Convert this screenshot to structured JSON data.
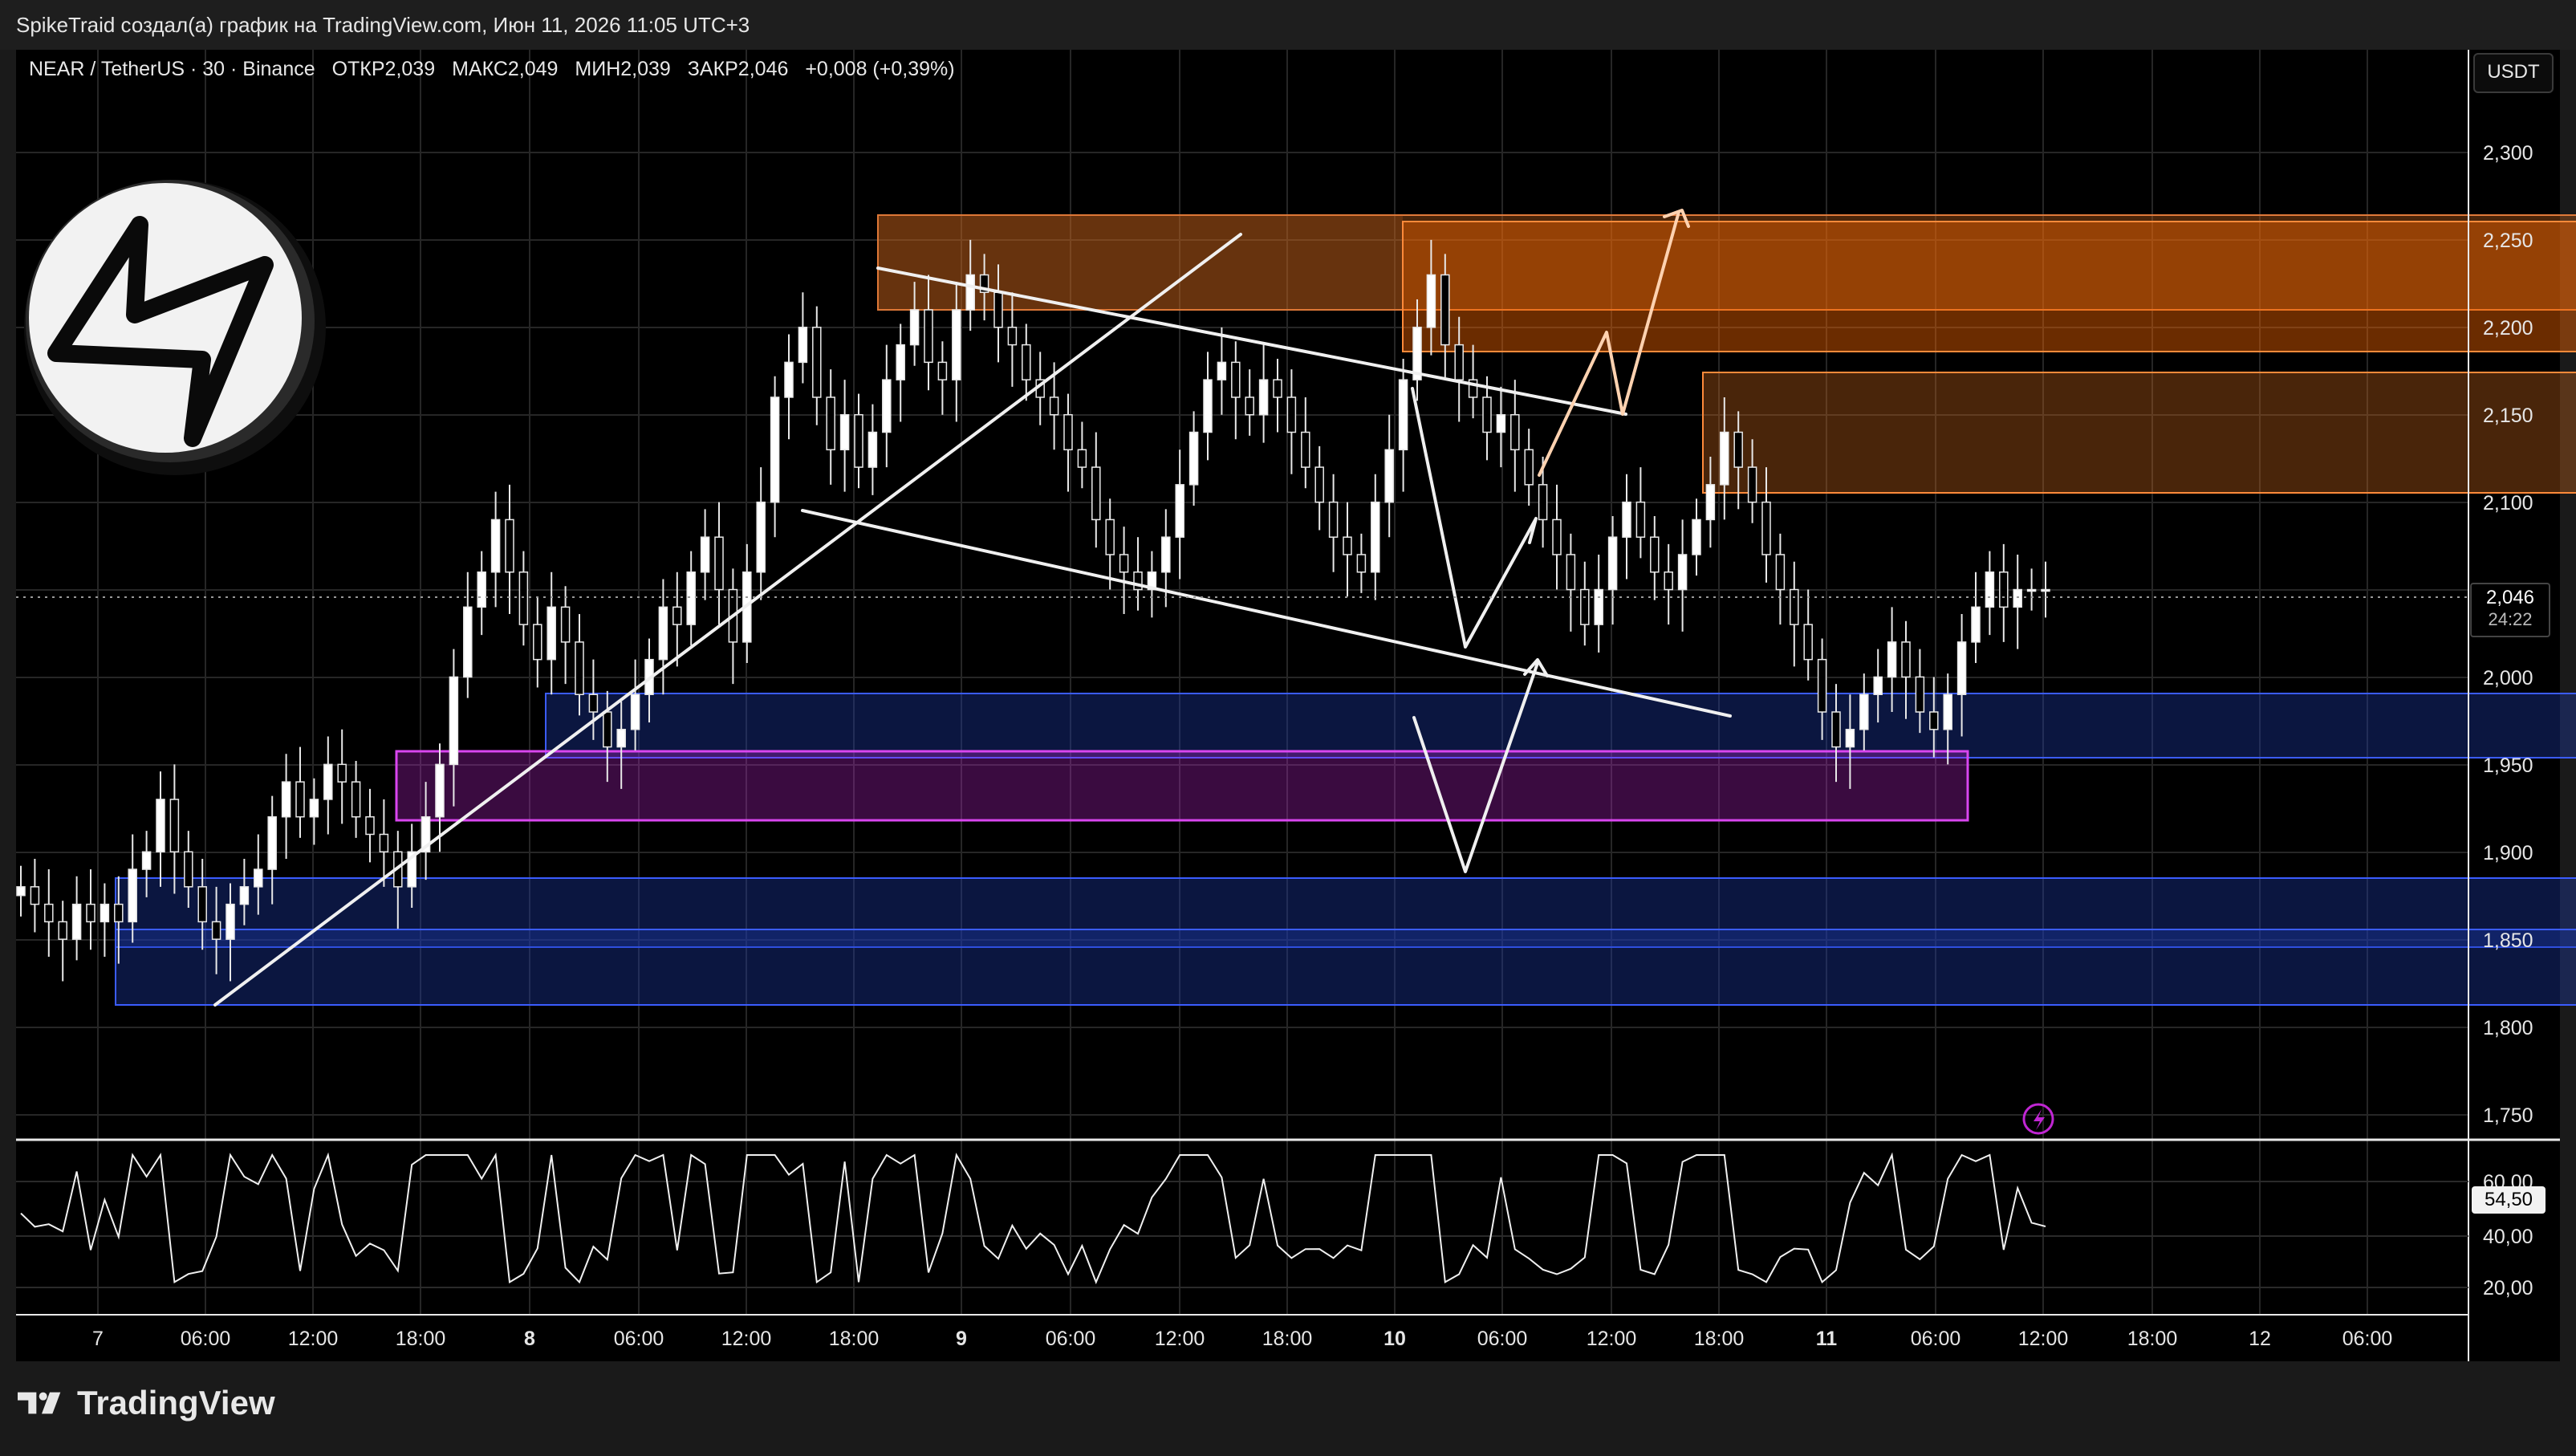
{
  "header": {
    "attribution": "SpikeTraid создал(а) график на TradingView.com, Июн 11, 2026 11:05 UTC+3"
  },
  "legend": {
    "symbol": "NEAR / TetherUS · 30 · Binance",
    "open": "ОТКР2,039",
    "high": "МАКС2,049",
    "low": "МИН2,039",
    "close": "ЗАКР2,046",
    "change": "+0,008 (+0,39%)"
  },
  "currency_button": "USDT",
  "price_labels": [
    "2,300",
    "2,250",
    "2,200",
    "2,150",
    "2,100",
    "2,050",
    "2,000",
    "1,950",
    "1,900",
    "1,850",
    "1,800",
    "1,750"
  ],
  "current_price": {
    "price": "2,046",
    "timer": "24:22"
  },
  "rsi": {
    "labels": [
      "60,00",
      "40,00",
      "20,00"
    ],
    "value": "54,50"
  },
  "time_labels": [
    "7",
    "06:00",
    "12:00",
    "18:00",
    "8",
    "06:00",
    "12:00",
    "18:00",
    "9",
    "06:00",
    "12:00",
    "18:00",
    "10",
    "06:00",
    "12:00",
    "18:00",
    "11",
    "06:00",
    "12:00",
    "18:00",
    "12",
    "06:00"
  ],
  "footer": {
    "brand": "TradingView"
  },
  "colors": {
    "supply_zone": "#d2691e",
    "demand_zone": "#1e3aa8",
    "key_zone": "#c026d3",
    "up_candle": "#ffffff",
    "down_candle": "#000000"
  },
  "chart_data": {
    "type": "candlestick",
    "symbol": "NEAR / TetherUS",
    "interval": "30",
    "ylim": [
      1.73,
      2.33
    ],
    "closes": [
      1.88,
      1.87,
      1.86,
      1.85,
      1.87,
      1.86,
      1.87,
      1.86,
      1.89,
      1.9,
      1.93,
      1.9,
      1.88,
      1.86,
      1.85,
      1.87,
      1.88,
      1.89,
      1.92,
      1.94,
      1.92,
      1.93,
      1.95,
      1.94,
      1.92,
      1.91,
      1.9,
      1.88,
      1.9,
      1.92,
      1.95,
      2.0,
      2.04,
      2.06,
      2.09,
      2.06,
      2.03,
      2.01,
      2.04,
      2.02,
      1.99,
      1.98,
      1.96,
      1.97,
      1.99,
      2.01,
      2.04,
      2.03,
      2.06,
      2.08,
      2.05,
      2.02,
      2.06,
      2.1,
      2.16,
      2.18,
      2.2,
      2.16,
      2.13,
      2.15,
      2.12,
      2.14,
      2.17,
      2.19,
      2.21,
      2.18,
      2.17,
      2.21,
      2.23,
      2.22,
      2.2,
      2.19,
      2.17,
      2.16,
      2.15,
      2.13,
      2.12,
      2.09,
      2.07,
      2.06,
      2.05,
      2.06,
      2.08,
      2.11,
      2.14,
      2.17,
      2.18,
      2.16,
      2.15,
      2.17,
      2.16,
      2.14,
      2.12,
      2.1,
      2.08,
      2.07,
      2.06,
      2.1,
      2.13,
      2.17,
      2.2,
      2.23,
      2.19,
      2.17,
      2.16,
      2.14,
      2.15,
      2.13,
      2.11,
      2.09,
      2.07,
      2.05,
      2.03,
      2.05,
      2.08,
      2.1,
      2.08,
      2.06,
      2.05,
      2.07,
      2.09,
      2.11,
      2.14,
      2.12,
      2.1,
      2.07,
      2.05,
      2.03,
      2.01,
      1.98,
      1.96,
      1.97,
      1.99,
      2.0,
      2.02,
      2.0,
      1.98,
      1.97,
      1.99,
      2.02,
      2.04,
      2.06,
      2.04,
      2.05,
      2.05,
      2.05
    ]
  }
}
